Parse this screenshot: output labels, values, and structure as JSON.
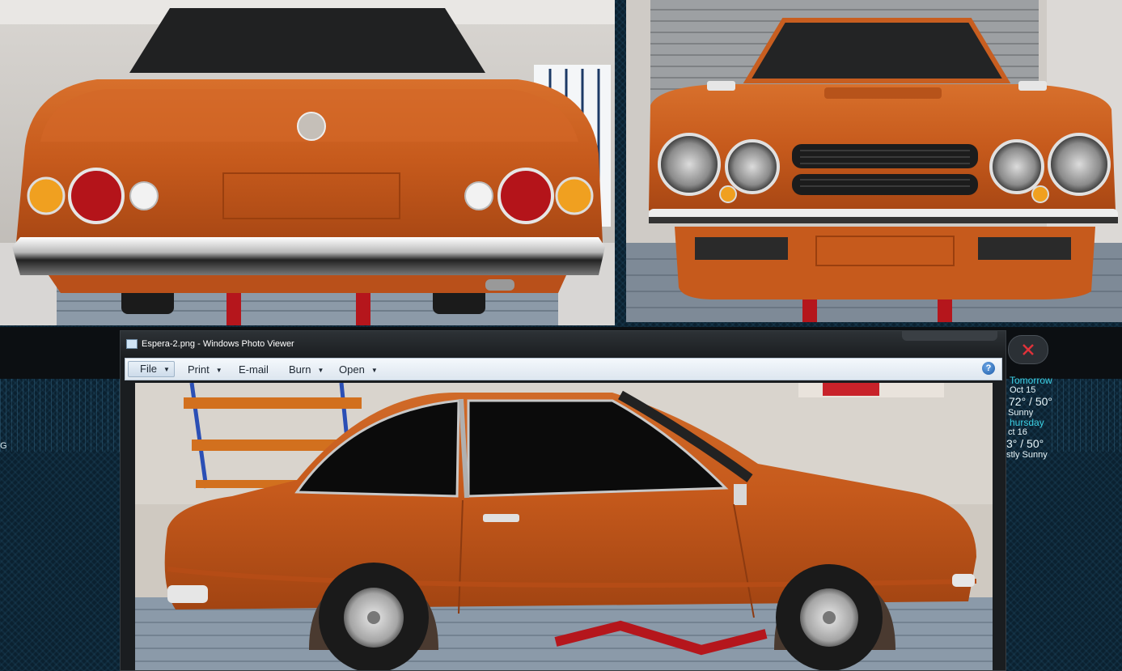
{
  "viewer": {
    "title": "Espera-2.png - Windows Photo Viewer",
    "menu": [
      {
        "label": "File",
        "has_arrow": true
      },
      {
        "label": "Print",
        "has_arrow": true
      },
      {
        "label": "E-mail",
        "has_arrow": false
      },
      {
        "label": "Burn",
        "has_arrow": true
      },
      {
        "label": "Open",
        "has_arrow": true
      }
    ],
    "help_glyph": "?"
  },
  "weather": {
    "day1": "Tomorrow",
    "date1": "Oct 15",
    "temp1": "72° / 50°",
    "cond1": "Sunny",
    "day2": "hursday",
    "date2": "ct 16",
    "temp2": "3° / 50°",
    "cond2": "stly Sunny"
  },
  "desktop": {
    "left_label": "G"
  },
  "colors": {
    "car_orange": "#c65a1c",
    "accent_blue": "#3cd2e6",
    "close_red": "#e0323a"
  }
}
